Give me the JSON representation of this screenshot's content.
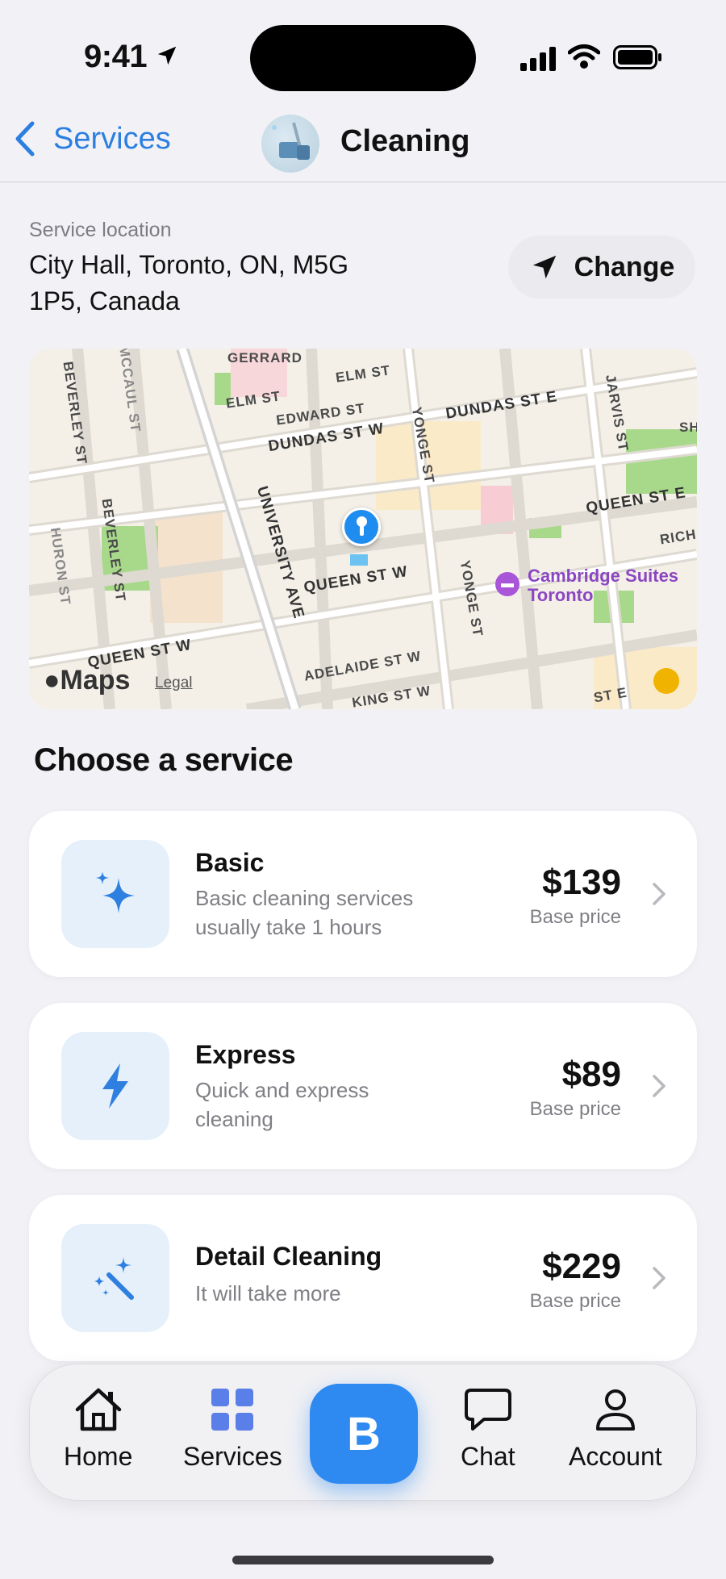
{
  "status_bar": {
    "time": "9:41"
  },
  "nav": {
    "back_label": "Services",
    "title": "Cleaning"
  },
  "location": {
    "caption": "Service location",
    "address": "City Hall, Toronto, ON, M5G 1P5, Canada",
    "change_label": "Change"
  },
  "map": {
    "streets": [
      "GERRARD",
      "ELM ST",
      "ELM ST",
      "EDWARD ST",
      "DUNDAS ST W",
      "DUNDAS ST E",
      "YONGE ST",
      "YONGE ST",
      "JARVIS ST",
      "BEVERLEY ST",
      "BEVERLEY ST",
      "MCCAUL ST",
      "HURON ST",
      "UNIVERSITY AVE",
      "QUEEN ST W",
      "QUEEN ST W",
      "QUEEN ST E",
      "ADELAIDE ST W",
      "KING ST W",
      "RICH",
      "SH",
      "ST E"
    ],
    "poi": "Cambridge Suites Toronto",
    "logo": "Maps",
    "legal": "Legal"
  },
  "section_title": "Choose a service",
  "services": [
    {
      "name": "Basic",
      "description": "Basic cleaning services usually take 1 hours",
      "price": "$139",
      "price_caption": "Base price",
      "icon": "sparkles-icon"
    },
    {
      "name": "Express",
      "description": "Quick and express cleaning",
      "price": "$89",
      "price_caption": "Base price",
      "icon": "lightning-icon"
    },
    {
      "name": "Detail Cleaning",
      "description": "It will take more",
      "price": "$229",
      "price_caption": "Base price",
      "icon": "magic-wand-icon"
    }
  ],
  "tabbar": {
    "home": "Home",
    "services": "Services",
    "center": "B",
    "chat": "Chat",
    "account": "Account"
  },
  "colors": {
    "accent": "#2e8af0",
    "link": "#2b7fe0",
    "icon_bg": "#e6f0fb",
    "background": "#f2f2f6"
  }
}
